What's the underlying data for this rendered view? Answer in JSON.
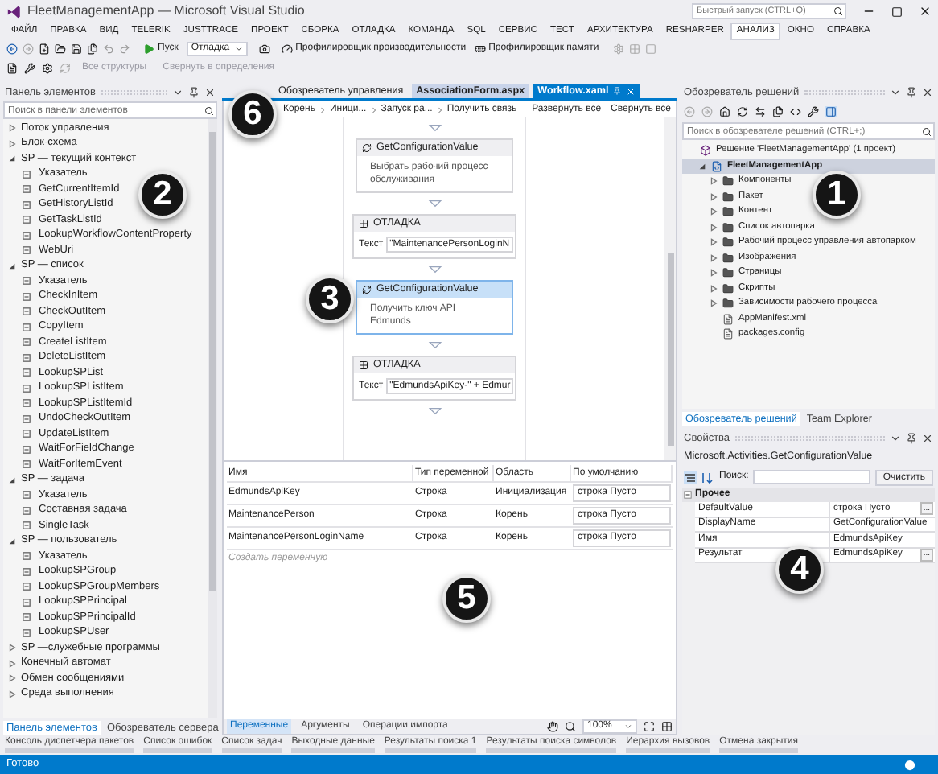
{
  "window": {
    "title": "FleetManagementApp — Microsoft Visual Studio",
    "quick_launch": {
      "placeholder": "Быстрый запуск (CTRL+Q)"
    }
  },
  "menu": [
    {
      "label": "ФАЙЛ",
      "selected": false
    },
    {
      "label": "ПРАВКА",
      "selected": false
    },
    {
      "label": "ВИД",
      "selected": false
    },
    {
      "label": "TELERIK",
      "selected": false
    },
    {
      "label": "JUSTTRACE",
      "selected": false
    },
    {
      "label": "ПРОЕКТ",
      "selected": false
    },
    {
      "label": "СБОРКА",
      "selected": false
    },
    {
      "label": "ОТЛАДКА",
      "selected": false
    },
    {
      "label": "КОМАНДА",
      "selected": false
    },
    {
      "label": "SQL",
      "selected": false
    },
    {
      "label": "СЕРВИС",
      "selected": false
    },
    {
      "label": "ТЕСТ",
      "selected": false
    },
    {
      "label": "АРХИТЕКТУРА",
      "selected": false
    },
    {
      "label": "RESHARPER",
      "selected": false
    },
    {
      "label": "АНАЛИЗ",
      "selected": true
    },
    {
      "label": "ОКНО",
      "selected": false
    },
    {
      "label": "СПРАВКА",
      "selected": false
    }
  ],
  "toolbar": {
    "start": "Пуск",
    "configuration": "Отладка",
    "perf_profiler": "Профилировщик производительности",
    "memory_profiler": "Профилировщик памяти"
  },
  "toolbar2": [
    {
      "label": "Все структуры",
      "disabled": true
    },
    {
      "label": "Свернуть в определения",
      "disabled": true
    }
  ],
  "toolbox": {
    "title": "Панель элементов",
    "search": {
      "placeholder": "Поиск в панели элементов"
    },
    "groups": [
      {
        "label": "Поток управления",
        "expanded": false
      },
      {
        "label": "Блок-схема",
        "expanded": false
      },
      {
        "label": "SP — текущий контекст",
        "expanded": true,
        "children": [
          "Указатель",
          "GetCurrentItemId",
          "GetHistoryListId",
          "GetTaskListId",
          "LookupWorkflowContentProperty",
          "WebUri"
        ]
      },
      {
        "label": "SP — список",
        "expanded": true,
        "children": [
          "Указатель",
          "CheckInItem",
          "CheckOutItem",
          "CopyItem",
          "CreateListItem",
          "DeleteListItem",
          "LookupSPList",
          "LookupSPListItem",
          "LookupSPListItemId",
          "UndoCheckOutItem",
          "UpdateListItem",
          "WaitForFieldChange",
          "WaitForItemEvent"
        ]
      },
      {
        "label": "SP — задача",
        "expanded": true,
        "children": [
          "Указатель",
          "Составная задача",
          "SingleTask"
        ]
      },
      {
        "label": "SP — пользователь",
        "expanded": true,
        "children": [
          "Указатель",
          "LookupSPGroup",
          "LookupSPGroupMembers",
          "LookupSPPrincipal",
          "LookupSPPrincipalId",
          "LookupSPUser"
        ]
      },
      {
        "label": "SP —служебные программы",
        "expanded": false
      },
      {
        "label": "Конечный автомат",
        "expanded": false
      },
      {
        "label": "Обмен сообщениями",
        "expanded": false
      },
      {
        "label": "Среда выполнения",
        "expanded": false
      }
    ],
    "tabs": [
      {
        "label": "Панель элементов",
        "selected": true
      },
      {
        "label": "Обозреватель сервера",
        "selected": false
      }
    ]
  },
  "editor": {
    "tabs": [
      {
        "label": "Обозреватель управления",
        "selected": false
      },
      {
        "label": "AssociationForm.aspx",
        "selected": false
      },
      {
        "label": "Workflow.xaml",
        "selected": true
      }
    ],
    "breadcrumb": [
      "Корень",
      "Иници...",
      "Запуск ра...",
      "Получить связь"
    ],
    "expand_all": "Развернуть все",
    "collapse_all": "Свернуть все",
    "activities": [
      {
        "kind": "config",
        "title": "GetConfigurationValue",
        "text": "Выбрать рабочий процесс обслуживания",
        "selected": false
      },
      {
        "kind": "debug",
        "title": "ОТЛАДКА",
        "label": "Текст",
        "value": "\"MaintenancePersonLoginN",
        "selected": false
      },
      {
        "kind": "config",
        "title": "GetConfigurationValue",
        "text": "Получить ключ API Edmunds",
        "selected": true
      },
      {
        "kind": "debug",
        "title": "ОТЛАДКА",
        "label": "Текст",
        "value": "\"EdmundsApiKey-\" + Edmur",
        "selected": false
      }
    ],
    "variables": {
      "columns": [
        "Имя",
        "Тип переменной",
        "Область",
        "По умолчанию"
      ],
      "rows": [
        [
          "EdmundsApiKey",
          "Строка",
          "Инициализация",
          "строка Пусто"
        ],
        [
          "MaintenancePerson",
          "Строка",
          "Корень",
          "строка Пусто"
        ],
        [
          "MaintenancePersonLoginName",
          "Строка",
          "Корень",
          "строка Пусто"
        ]
      ],
      "create": "Создать переменную"
    },
    "bottom_tabs": [
      {
        "label": "Переменные",
        "selected": true
      },
      {
        "label": "Аргументы",
        "selected": false
      },
      {
        "label": "Операции импорта",
        "selected": false
      }
    ],
    "zoom": "100%"
  },
  "solution_explorer": {
    "title": "Обозреватель решений",
    "search": {
      "placeholder": "Поиск в обозревателе решений (CTRL+;)"
    },
    "tree": [
      {
        "label": "Решение 'FleetManagementApp' (1 проект)",
        "kind": "solution",
        "selected": false,
        "children": [
          {
            "label": "FleetManagementApp",
            "kind": "project",
            "selected": true,
            "expanded": true,
            "children": [
              {
                "label": "Компоненты",
                "kind": "folder",
                "selected": false,
                "expanded": false
              },
              {
                "label": "Пакет",
                "kind": "folder",
                "selected": false,
                "expanded": false
              },
              {
                "label": "Контент",
                "kind": "folder",
                "selected": false,
                "expanded": false
              },
              {
                "label": "Список автопарка",
                "kind": "folder",
                "selected": false,
                "expanded": false
              },
              {
                "label": "Рабочий процесс управления автопарком",
                "kind": "folder",
                "selected": false,
                "expanded": false
              },
              {
                "label": "Изображения",
                "kind": "folder",
                "selected": false,
                "expanded": false
              },
              {
                "label": "Страницы",
                "kind": "folder",
                "selected": false,
                "expanded": false
              },
              {
                "label": "Скрипты",
                "kind": "folder",
                "selected": false,
                "expanded": false
              },
              {
                "label": "Зависимости рабочего процесса",
                "kind": "folder",
                "selected": false,
                "expanded": false
              },
              {
                "label": "AppManifest.xml",
                "kind": "file",
                "selected": false
              },
              {
                "label": "packages.config",
                "kind": "file",
                "selected": false
              }
            ]
          }
        ]
      }
    ],
    "tabs": [
      {
        "label": "Обозреватель решений",
        "selected": true
      },
      {
        "label": "Team Explorer",
        "selected": false
      }
    ]
  },
  "properties": {
    "title": "Свойства",
    "type": "Microsoft.Activities.GetConfigurationValue",
    "search_label": "Поиск:",
    "clear": "Очистить",
    "category": "Прочее",
    "rows": [
      {
        "name": "DefaultValue",
        "value": "строка Пусто",
        "button": "..."
      },
      {
        "name": "DisplayName",
        "value": "GetConfigurationValue"
      },
      {
        "name": "Имя",
        "value": "EdmundsApiKey"
      },
      {
        "name": "Результат",
        "value": "EdmundsApiKey",
        "button": "..."
      }
    ]
  },
  "output_tabs": [
    "Консоль диспетчера пакетов",
    "Список ошибок",
    "Список задач",
    "Выходные данные",
    "Результаты поиска 1",
    "Результаты поиска символов",
    "Иерархия вызовов",
    "Отмена закрытия"
  ],
  "status_bar": {
    "text": "Готово"
  },
  "callouts": [
    "1",
    "2",
    "3",
    "4",
    "5",
    "6"
  ]
}
